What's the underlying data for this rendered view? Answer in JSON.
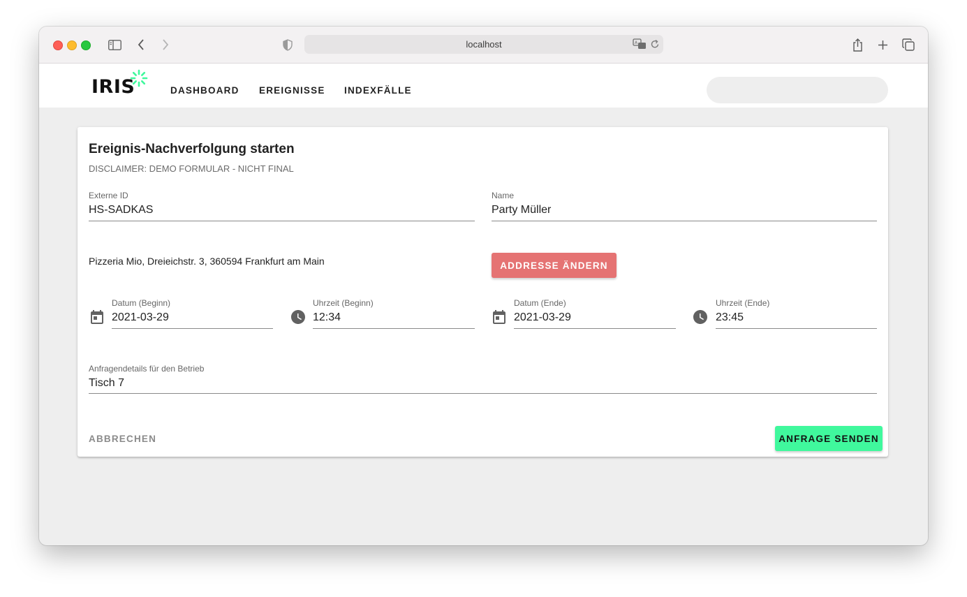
{
  "browser": {
    "url": "localhost"
  },
  "app": {
    "logo_text": "IRIS",
    "nav": [
      "DASHBOARD",
      "EREIGNISSE",
      "INDEXFÄLLE"
    ],
    "accent_color": "#40f89d"
  },
  "form": {
    "title": "Ereignis-Nachverfolgung starten",
    "subtitle": "DISCLAIMER: DEMO FORMULAR - NICHT FINAL",
    "external_id": {
      "label": "Externe ID",
      "value": "HS-SADKAS"
    },
    "name": {
      "label": "Name",
      "value": "Party Müller"
    },
    "address": "Pizzeria Mio, Dreieichstr. 3, 360594 Frankfurt am Main",
    "change_address_label": "ADDRESSE ÄNDERN",
    "start_date": {
      "label": "Datum (Beginn)",
      "value": "2021-03-29",
      "icon": "calendar-icon"
    },
    "start_time": {
      "label": "Uhrzeit (Beginn)",
      "value": "12:34",
      "icon": "clock-icon"
    },
    "end_date": {
      "label": "Datum (Ende)",
      "value": "2021-03-29",
      "icon": "calendar-icon"
    },
    "end_time": {
      "label": "Uhrzeit (Ende)",
      "value": "23:45",
      "icon": "clock-icon"
    },
    "details": {
      "label": "Anfragendetails für den Betrieb",
      "value": "Tisch 7"
    },
    "cancel_label": "ABBRECHEN",
    "submit_label": "ANFRAGE SENDEN"
  }
}
